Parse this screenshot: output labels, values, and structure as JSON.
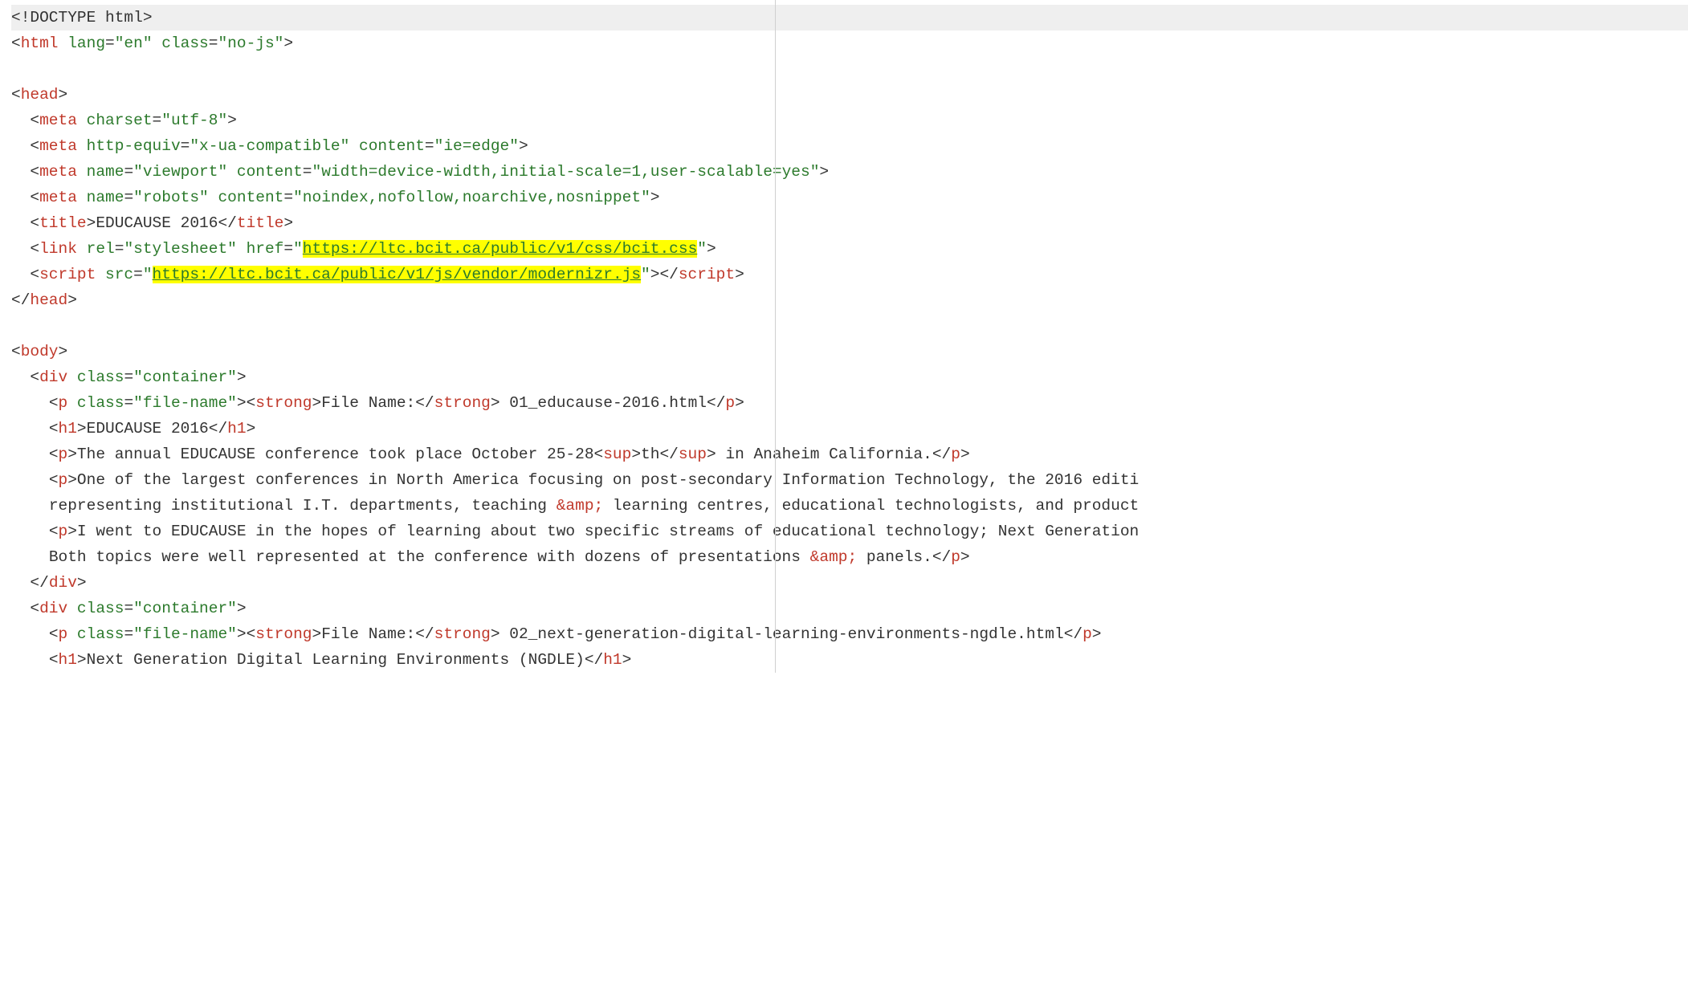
{
  "lines": {
    "l1_doctype": "!DOCTYPE html",
    "l2_tag": "html",
    "l2_a1n": "lang",
    "l2_a1v": "\"en\"",
    "l2_a2n": "class",
    "l2_a2v": "\"no-js\"",
    "l4_tag": "head",
    "l5_tag": "meta",
    "l5_a1n": "charset",
    "l5_a1v": "\"utf-8\"",
    "l6_tag": "meta",
    "l6_a1n": "http-equiv",
    "l6_a1v": "\"x-ua-compatible\"",
    "l6_a2n": "content",
    "l6_a2v": "\"ie=edge\"",
    "l7_tag": "meta",
    "l7_a1n": "name",
    "l7_a1v": "\"viewport\"",
    "l7_a2n": "content",
    "l7_a2v": "\"width=device-width,initial-scale=1,user-scalable=yes\"",
    "l8_tag": "meta",
    "l8_a1n": "name",
    "l8_a1v": "\"robots\"",
    "l8_a2n": "content",
    "l8_a2v": "\"noindex,nofollow,noarchive,nosnippet\"",
    "l9_tag": "title",
    "l9_text": "EDUCAUSE 2016",
    "l10_tag": "link",
    "l10_a1n": "rel",
    "l10_a1v": "\"stylesheet\"",
    "l10_a2n": "href",
    "l10_a2v_q": "\"",
    "l10_a2v_url": "https://ltc.bcit.ca/public/v1/css/bcit.css",
    "l11_tag": "script",
    "l11_a1n": "src",
    "l11_a1v_q": "\"",
    "l11_a1v_url": "https://ltc.bcit.ca/public/v1/js/vendor/modernizr.js",
    "l14_tag": "body",
    "l15_tag": "div",
    "l15_a1n": "class",
    "l15_a1v": "\"container\"",
    "l16_tag": "p",
    "l16_a1n": "class",
    "l16_a1v": "\"file-name\"",
    "l16_strong": "strong",
    "l16_label": "File Name:",
    "l16_text": " 01_educause-2016.html",
    "l17_tag": "h1",
    "l17_text": "EDUCAUSE 2016",
    "l18_tag": "p",
    "l18_t1": "The annual EDUCAUSE conference took place October 25-28",
    "l18_sup": "sup",
    "l18_supt": "th",
    "l18_t2": " in Anaheim California.",
    "l19_tag": "p",
    "l19_t1": "One of the largest conferences in North America focusing on post-secondary Information Technology, the 2016 editi",
    "l20_t1": "representing institutional I.T. departments, teaching ",
    "l20_amp": "&amp;",
    "l20_t2": " learning centres, educational technologists, and product",
    "l21_tag": "p",
    "l21_t1": "I went to EDUCAUSE in the hopes of learning about two specific streams of educational technology; Next Generation",
    "l22_t1": "Both topics were well represented at the conference with dozens of presentations ",
    "l22_amp": "&amp;",
    "l22_t2": " panels.",
    "l23_tag": "div",
    "l24_tag": "div",
    "l24_a1n": "class",
    "l24_a1v": "\"container\"",
    "l25_tag": "p",
    "l25_a1n": "class",
    "l25_a1v": "\"file-name\"",
    "l25_strong": "strong",
    "l25_label": "File Name:",
    "l25_text": " 02_next-generation-digital-learning-environments-ngdle.html",
    "l26_tag": "h1",
    "l26_text": "Next Generation Digital Learning Environments (NGDLE)"
  }
}
